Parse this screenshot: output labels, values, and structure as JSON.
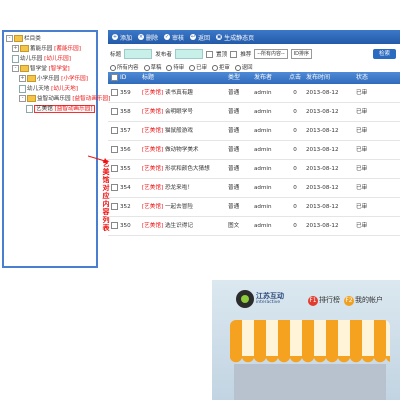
{
  "tree": {
    "root": "栏目类",
    "items": [
      {
        "indent": 0,
        "type": "folder",
        "label": "蓄能乐园",
        "tag": "[蓄能乐园]",
        "expanded": "+"
      },
      {
        "indent": 0,
        "type": "doc",
        "label": "幼儿乐园",
        "tag": "[幼儿乐园]"
      },
      {
        "indent": 0,
        "type": "folder",
        "label": "智学堂",
        "tag": "[智学堂]",
        "expanded": "-"
      },
      {
        "indent": 1,
        "type": "folder",
        "label": "小学乐园",
        "tag": "[小学乐园]",
        "expanded": "+"
      },
      {
        "indent": 1,
        "type": "doc",
        "label": "幼儿天地",
        "tag": "[幼儿天地]"
      },
      {
        "indent": 1,
        "type": "folder",
        "label": "益智动画乐园",
        "tag": "[益智动画乐园]",
        "expanded": "-"
      },
      {
        "indent": 2,
        "type": "doc",
        "label": "艺美馆",
        "tag": "[益智动画乐园]",
        "selected": true
      }
    ]
  },
  "annotation": "艺美馆对应内容列表",
  "toolbar": [
    {
      "icon": "add-icon",
      "glyph": "+",
      "label": "添加"
    },
    {
      "icon": "delete-icon",
      "glyph": "×",
      "label": "删除"
    },
    {
      "icon": "review-icon",
      "glyph": "✓",
      "label": "审核"
    },
    {
      "icon": "back-icon",
      "glyph": "↩",
      "label": "返回"
    },
    {
      "icon": "generate-icon",
      "glyph": "▣",
      "label": "生成静态页"
    }
  ],
  "search": {
    "title_label": "标题",
    "publisher_label": "发布者",
    "top_label": "置顶",
    "recommend_label": "推荐",
    "type_select": "--所有内容--",
    "order_select": "ID排序",
    "button": "检索"
  },
  "filters": [
    "所有内容",
    "草稿",
    "待审",
    "已审",
    "拒审",
    "退回"
  ],
  "columns": [
    "ID",
    "标题",
    "类型",
    "发布者",
    "点击",
    "发布时间",
    "状态"
  ],
  "rows": [
    {
      "id": "359",
      "tag": "[艺美馆]",
      "title": "读书真有趣",
      "type": "普通",
      "author": "admin",
      "clicks": "0",
      "date": "2013-08-12",
      "status": "已审"
    },
    {
      "id": "358",
      "tag": "[艺美馆]",
      "title": "会明眼学号",
      "type": "普通",
      "author": "admin",
      "clicks": "0",
      "date": "2013-08-12",
      "status": "已审"
    },
    {
      "id": "357",
      "tag": "[艺美馆]",
      "title": "猫鼠般游戏",
      "type": "普通",
      "author": "admin",
      "clicks": "0",
      "date": "2013-08-12",
      "status": "已审"
    },
    {
      "id": "356",
      "tag": "[艺美馆]",
      "title": "做动物学美术",
      "type": "普通",
      "author": "admin",
      "clicks": "0",
      "date": "2013-08-12",
      "status": "已审"
    },
    {
      "id": "355",
      "tag": "[艺美馆]",
      "title": "形状和颜色大猜想",
      "type": "普通",
      "author": "admin",
      "clicks": "0",
      "date": "2013-08-12",
      "status": "已审"
    },
    {
      "id": "354",
      "tag": "[艺美馆]",
      "title": "恐龙来啦！",
      "type": "普通",
      "author": "admin",
      "clicks": "0",
      "date": "2013-08-12",
      "status": "已审"
    },
    {
      "id": "352",
      "tag": "[艺美馆]",
      "title": "一起去冒险",
      "type": "普通",
      "author": "admin",
      "clicks": "0",
      "date": "2013-08-12",
      "status": "已审"
    },
    {
      "id": "350",
      "tag": "[艺美馆]",
      "title": "选生识得记",
      "type": "图文",
      "author": "admin",
      "clicks": "0",
      "date": "2013-08-12",
      "status": "已审"
    }
  ],
  "banner": {
    "brand": "江苏互动",
    "brand_sub": "interactive",
    "nav": [
      {
        "badge": "F1",
        "label": "排行榜",
        "color": "#e23b2e"
      },
      {
        "badge": "F2",
        "label": "我的帐户",
        "color": "#f0a020"
      }
    ]
  },
  "colors": {
    "accent": "#2a62b4",
    "tag_red": "#e11111",
    "tree_border": "#4a7fcf"
  }
}
